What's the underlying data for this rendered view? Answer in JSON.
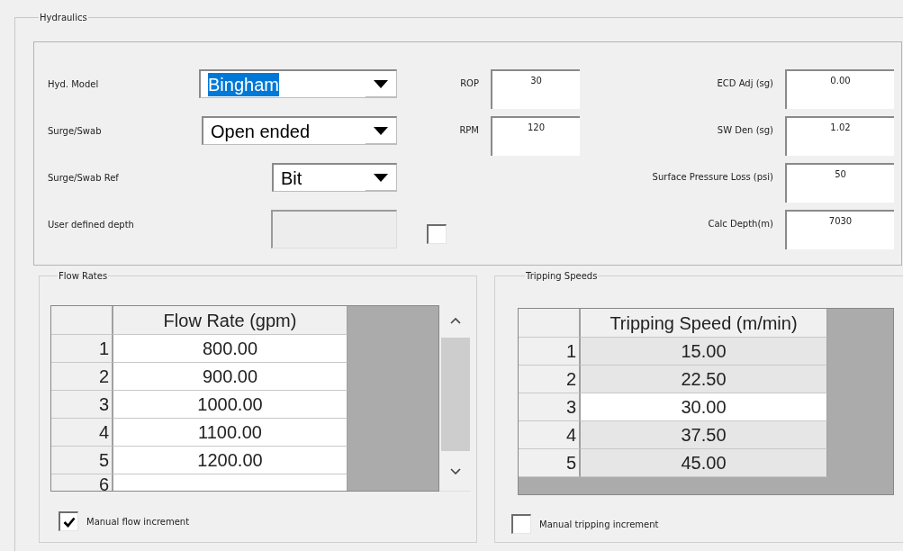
{
  "group_title": "Hydraulics",
  "left_rows": [
    {
      "kind": "combo",
      "label": "Hyd. Model",
      "value": "Bingham",
      "highlighted": true
    },
    {
      "kind": "combo",
      "label": "Surge/Swab",
      "value": "Open ended",
      "highlighted": false
    },
    {
      "kind": "combo",
      "label": "Surge/Swab Ref",
      "value": "Bit",
      "highlighted": false
    },
    {
      "kind": "field",
      "label": "User defined depth",
      "disabled": true,
      "checkbox": {
        "checked": false
      }
    }
  ],
  "middle_fields": [
    {
      "label": "ROP",
      "value": "30"
    },
    {
      "label": "RPM",
      "value": "120"
    }
  ],
  "right_fields": [
    {
      "label": "ECD Adj (sg)",
      "value": "0.00"
    },
    {
      "label": "SW Den (sg)",
      "value": "1.02"
    },
    {
      "label": "Surface Pressure Loss (psi)",
      "value": "50"
    },
    {
      "label": "Calc Depth(m)",
      "value": "7030"
    }
  ],
  "flow_rates": {
    "title": "Flow Rates",
    "table": {
      "header": "Flow Rate (gpm)",
      "editable": true,
      "scrollbar": true,
      "rows": [
        {
          "number": "1",
          "value": "800.00"
        },
        {
          "number": "2",
          "value": "900.00"
        },
        {
          "number": "3",
          "value": "1000.00"
        },
        {
          "number": "4",
          "value": "1100.00"
        },
        {
          "number": "5",
          "value": "1200.00"
        },
        {
          "number": "6"
        }
      ]
    },
    "checkbox": {
      "label": "Manual flow increment",
      "checked": true
    }
  },
  "tripping_speeds": {
    "title": "Tripping Speeds",
    "table": {
      "header": "Tripping Speed (m/min)",
      "editable": false,
      "scrollbar": false,
      "rows": [
        {
          "number": "1",
          "value": "15.00",
          "selected": false
        },
        {
          "number": "2",
          "value": "22.50",
          "selected": false
        },
        {
          "number": "3",
          "value": "30.00",
          "selected": true
        },
        {
          "number": "4",
          "value": "37.50",
          "selected": false
        },
        {
          "number": "5",
          "value": "45.00",
          "selected": false
        }
      ]
    },
    "checkbox": {
      "label": "Manual tripping increment",
      "checked": false
    }
  }
}
